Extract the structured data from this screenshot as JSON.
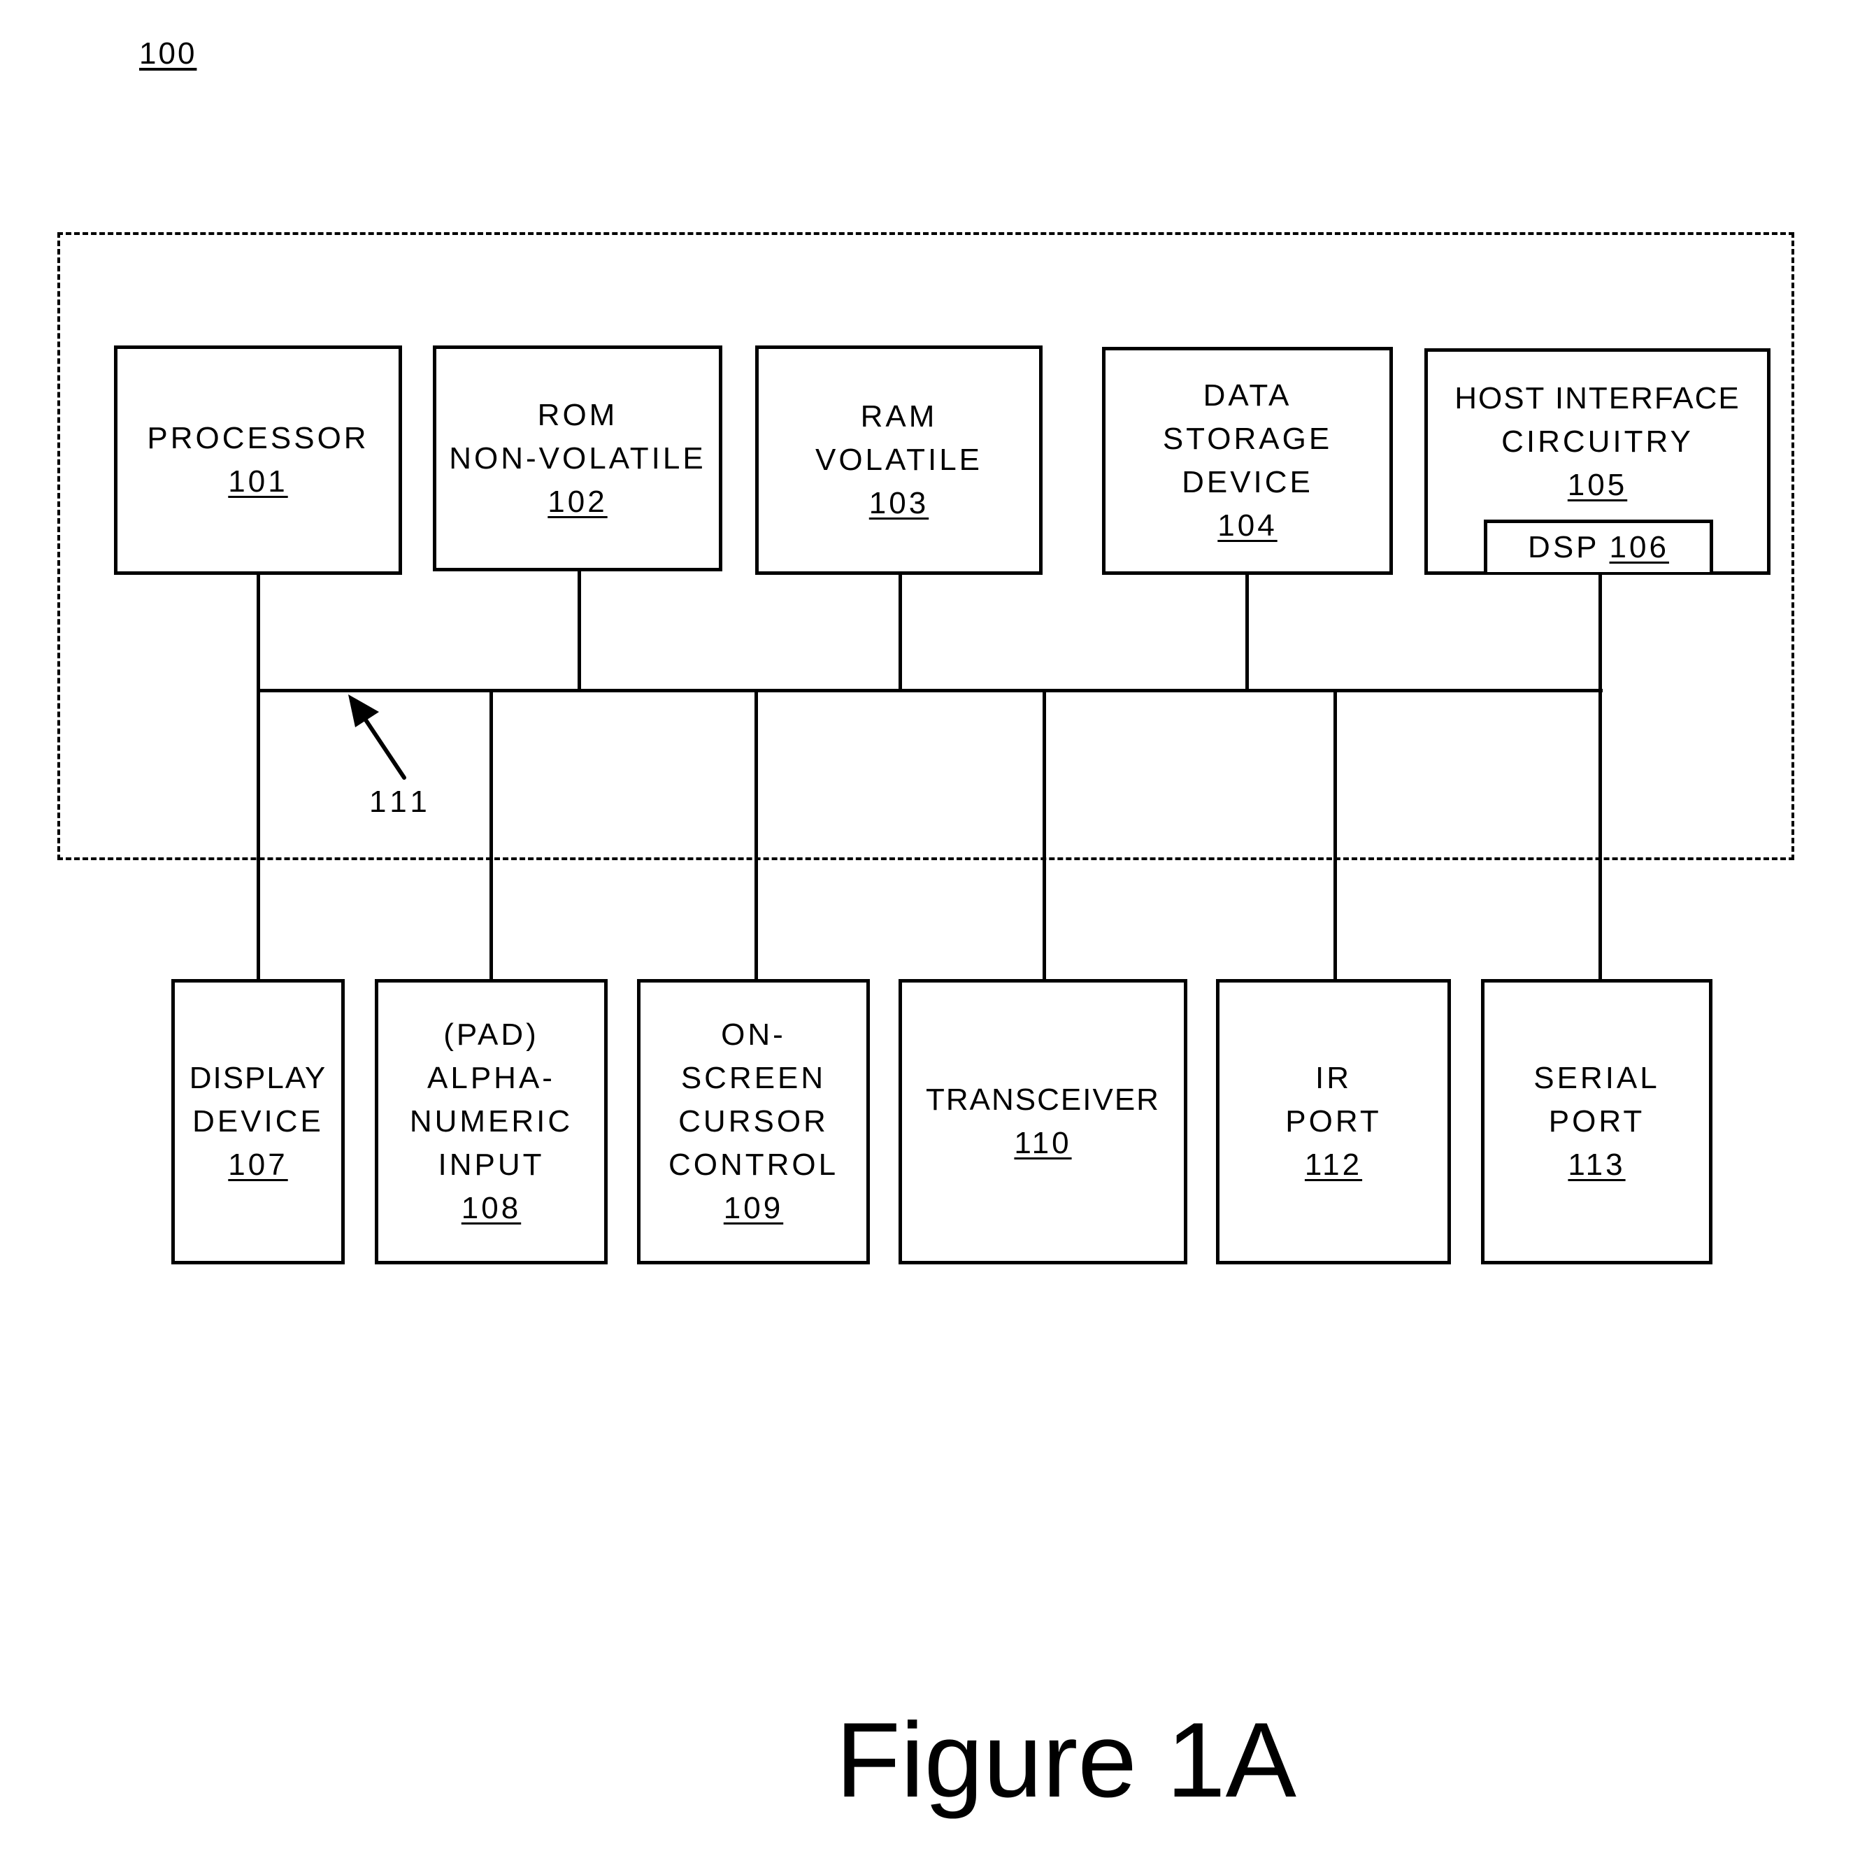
{
  "figure": {
    "reference_number": "100",
    "caption": "Figure 1A",
    "bus": {
      "reference_number": "111"
    }
  },
  "upper_blocks": [
    {
      "id": "processor",
      "lines": [
        "PROCESSOR"
      ],
      "ref": "101"
    },
    {
      "id": "rom",
      "lines": [
        "ROM",
        "NON-VOLATILE"
      ],
      "ref": "102"
    },
    {
      "id": "ram",
      "lines": [
        "RAM",
        "VOLATILE"
      ],
      "ref": "103"
    },
    {
      "id": "data-storage",
      "lines": [
        "DATA",
        "STORAGE",
        "DEVICE"
      ],
      "ref": "104"
    },
    {
      "id": "host-interface",
      "lines": [
        "HOST INTERFACE",
        "CIRCUITRY"
      ],
      "ref": "105",
      "sub_block": {
        "label": "DSP",
        "ref": "106"
      }
    }
  ],
  "lower_blocks": [
    {
      "id": "display-device",
      "lines": [
        "DISPLAY",
        "DEVICE"
      ],
      "ref": "107"
    },
    {
      "id": "alphanumeric-input",
      "lines": [
        "(PAD)",
        "ALPHA-",
        "NUMERIC",
        "INPUT"
      ],
      "ref": "108"
    },
    {
      "id": "cursor-control",
      "lines": [
        "ON-",
        "SCREEN",
        "CURSOR",
        "CONTROL"
      ],
      "ref": "109"
    },
    {
      "id": "transceiver",
      "lines": [
        "TRANSCEIVER"
      ],
      "ref": "110"
    },
    {
      "id": "ir-port",
      "lines": [
        "IR",
        "PORT"
      ],
      "ref": "112"
    },
    {
      "id": "serial-port",
      "lines": [
        "SERIAL",
        "PORT"
      ],
      "ref": "113"
    }
  ]
}
